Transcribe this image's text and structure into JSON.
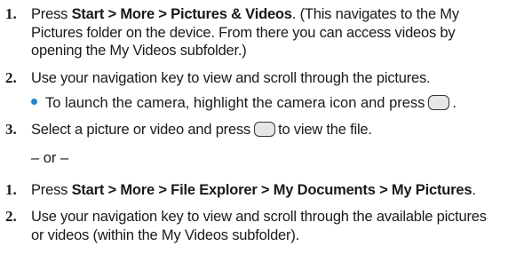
{
  "section1": {
    "step1": {
      "number": "1.",
      "prefix": "Press ",
      "path": "Start > More > Pictures & Videos",
      "suffix_line1": ". (This navigates to the My",
      "line2": "Pictures folder on the device. From there you can access videos by",
      "line3": "opening the My Videos subfolder.)"
    },
    "step2": {
      "number": "2.",
      "text": "Use your navigation key to view and scroll through the pictures."
    },
    "bullet": {
      "text_before": "To launch the camera, highlight the camera icon and press",
      "text_after": "."
    },
    "step3": {
      "number": "3.",
      "text_before": "Select a picture or video and press",
      "text_after": "to view the file."
    }
  },
  "separator": "– or –",
  "section2": {
    "step1": {
      "number": "1.",
      "prefix": "Press ",
      "path": "Start > More > File Explorer > My Documents > My Pictures",
      "suffix": "."
    },
    "step2": {
      "number": "2.",
      "line1": "Use your navigation key to view and scroll through the available pictures",
      "line2": "or videos (within the My Videos subfolder)."
    }
  }
}
